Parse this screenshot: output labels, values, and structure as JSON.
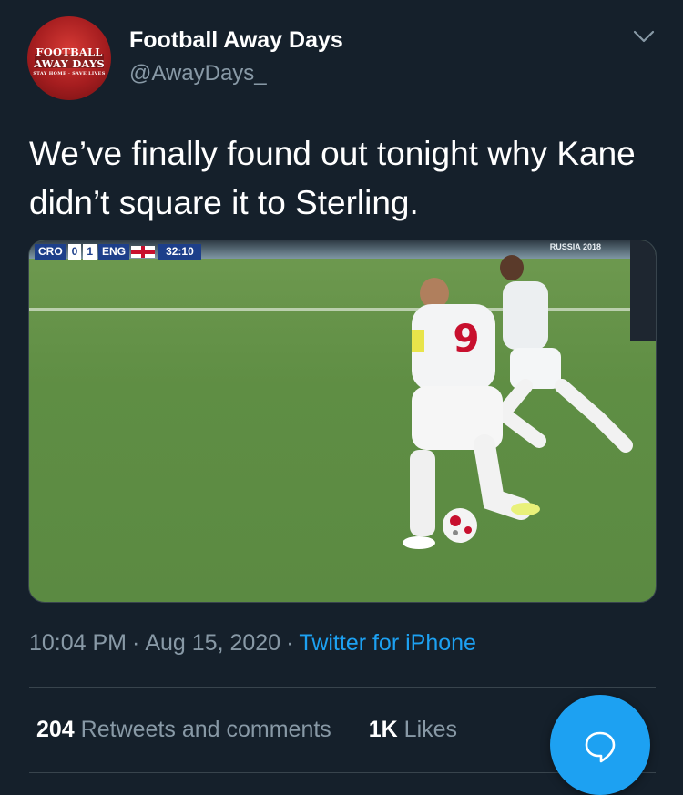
{
  "user": {
    "display_name": "Football Away Days",
    "handle": "@AwayDays_",
    "avatar": {
      "line1": "FOOTBALL",
      "line2": "AWAY DAYS",
      "line3": "STAY HOME · SAVE LIVES"
    }
  },
  "tweet": {
    "text": "We’ve finally found out tonight why Kane didn’t square it to Sterling.",
    "time": "10:04 PM",
    "date": "Aug 15, 2020",
    "source": "Twitter for iPhone",
    "separator": "·"
  },
  "media": {
    "description": "Football match video still",
    "scorebug": {
      "team1": "CRO",
      "score1": "0",
      "score2": "1",
      "team2": "ENG",
      "clock": "32:10"
    },
    "tournament_text": "RUSSIA 2018"
  },
  "stats": {
    "retweets_count": "204",
    "retweets_label": "Retweets and comments",
    "likes_count": "1K",
    "likes_label": "Likes"
  },
  "icons": {
    "more": "chevron-down-icon",
    "compose": "reply-bubble-icon"
  },
  "colors": {
    "background": "#15202b",
    "accent": "#1da1f2",
    "muted": "#8899a6",
    "divider": "#38444d"
  }
}
